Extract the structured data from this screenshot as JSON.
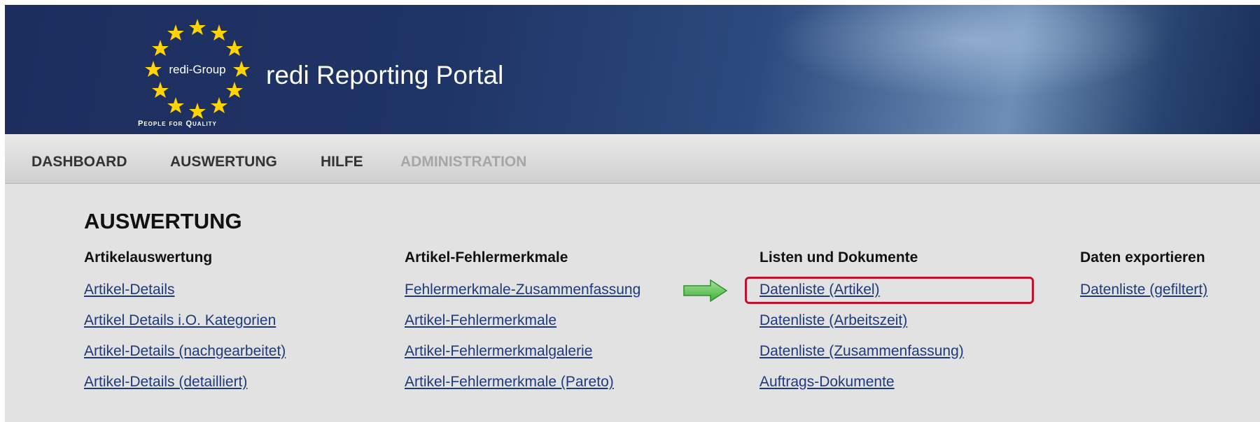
{
  "header": {
    "logo_text": "redi-Group",
    "tagline": "People for Quality",
    "portal_title": "redi Reporting Portal"
  },
  "nav": [
    {
      "label": "DASHBOARD",
      "enabled": true
    },
    {
      "label": "AUSWERTUNG",
      "enabled": true
    },
    {
      "label": "HILFE",
      "enabled": true
    },
    {
      "label": "ADMINISTRATION",
      "enabled": false
    }
  ],
  "main": {
    "title": "AUSWERTUNG",
    "columns": [
      {
        "heading": "Artikelauswertung",
        "links": [
          "Artikel-Details",
          "Artikel Details i.O. Kategorien",
          "Artikel-Details (nachgearbeitet)",
          "Artikel-Details (detailliert)"
        ]
      },
      {
        "heading": "Artikel-Fehlermerkmale",
        "links": [
          "Fehlermerkmale-Zusammenfassung",
          "Artikel-Fehlermerkmale",
          "Artikel-Fehlermerkmalgalerie",
          "Artikel-Fehlermerkmale (Pareto)"
        ]
      },
      {
        "heading": "Listen und Dokumente",
        "links": [
          "Datenliste (Artikel)",
          "Datenliste (Arbeitszeit)",
          "Datenliste (Zusammenfassung)",
          "Auftrags-Dokumente"
        ]
      },
      {
        "heading": "Daten exportieren",
        "links": [
          "Datenliste (gefiltert)"
        ]
      }
    ]
  },
  "annotations": {
    "arrow_icon": "green-right-arrow-icon",
    "highlight_color": "#c40f2f"
  },
  "colors": {
    "header_bg": "#1f3466",
    "link": "#1f3a7a",
    "nav_disabled": "#a6a6a6"
  }
}
